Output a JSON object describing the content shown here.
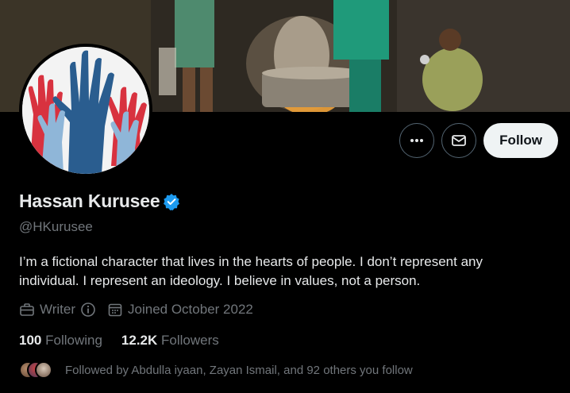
{
  "profile": {
    "display_name": "Hassan Kurusee",
    "handle": "@HKurusee",
    "verified": true,
    "bio": "I’m a fictional character that lives in the hearts of people. I don’t represent any individual. I represent an ideology. I believe in values, not a person.",
    "profession": "Writer",
    "joined": "Joined October 2022"
  },
  "actions": {
    "more_icon": "more-icon",
    "message_icon": "envelope-icon",
    "follow_label": "Follow"
  },
  "stats": {
    "following_count": "100",
    "following_label": "Following",
    "followers_count": "12.2K",
    "followers_label": "Followers"
  },
  "followed_by": {
    "text": "Followed by Abdulla iyaan, Zayan Ismail, and 92 others you follow"
  },
  "colors": {
    "background": "#000000",
    "verified_blue": "#1d9bf0",
    "secondary_text": "#71767b",
    "primary_text": "#e7e9ea",
    "follow_button_bg": "#eff3f4"
  }
}
